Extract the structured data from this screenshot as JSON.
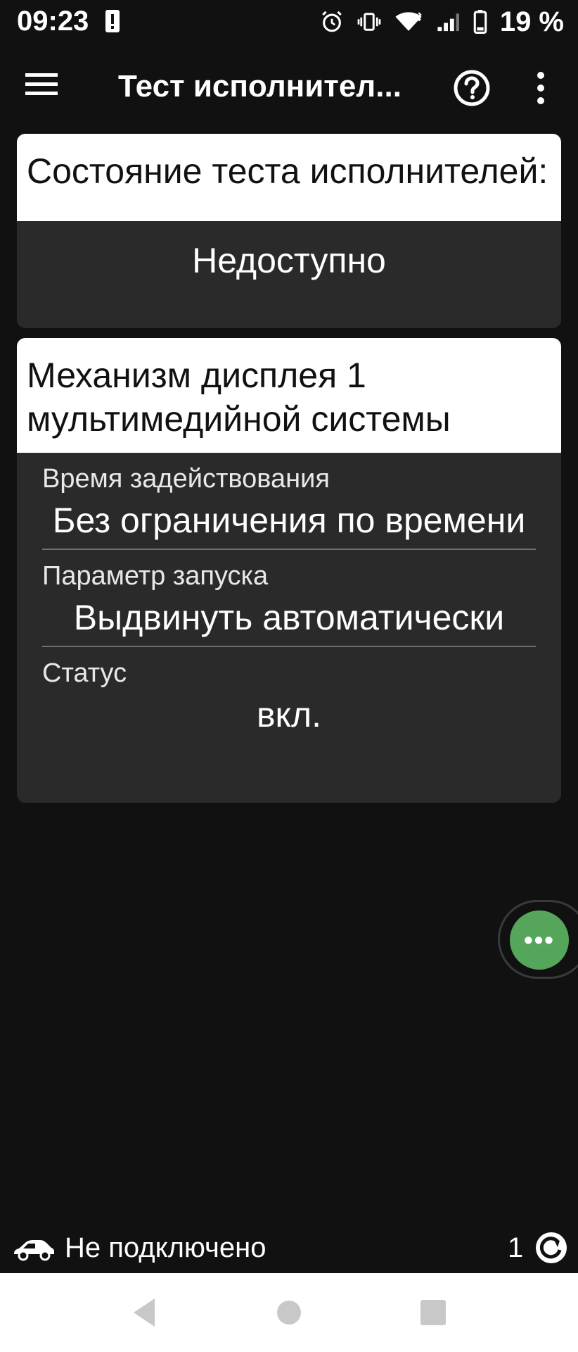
{
  "status_bar": {
    "time": "09:23",
    "battery_pct": "19 %"
  },
  "app_bar": {
    "title": "Тест исполнител...",
    "icons": [
      "menu-icon",
      "help-icon",
      "more-vert-icon"
    ]
  },
  "card_state": {
    "header": "Состояние теста исполнителей:",
    "value": "Недоступно"
  },
  "card_actuator": {
    "header": "Механизм дисплея 1 мультимедийной системы",
    "params": [
      {
        "label": "Время задействования",
        "value": "Без ограничения по времени"
      },
      {
        "label": "Параметр запуска",
        "value": "Выдвинуть автоматически"
      },
      {
        "label": "Статус",
        "value": "вкл."
      }
    ]
  },
  "fab": {
    "label": "•••",
    "color": "#55a65a"
  },
  "connection": {
    "text": "Не подключено",
    "count": "1"
  },
  "colors": {
    "background": "#111111",
    "card_body": "#2a2a2a",
    "card_header": "#ffffff",
    "accent": "#55a65a"
  }
}
